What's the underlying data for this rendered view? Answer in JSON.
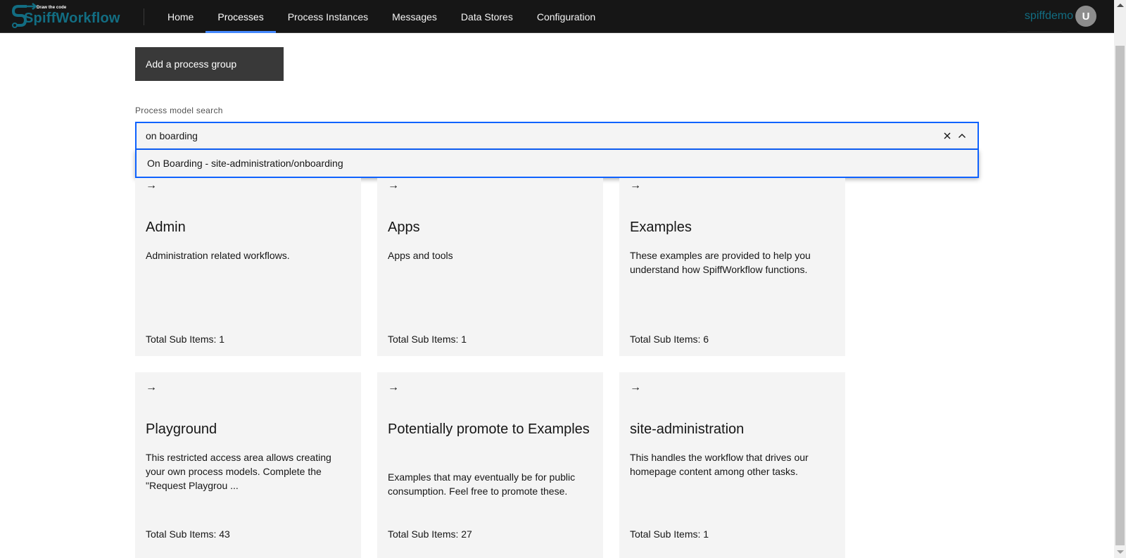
{
  "app": {
    "logo_tagline": "Draw the code",
    "logo_name": "SpiffWorkflow",
    "brand_color": "#126d82",
    "accent_color": "#0f62fe"
  },
  "nav": {
    "items": [
      {
        "label": "Home",
        "active": false
      },
      {
        "label": "Processes",
        "active": true
      },
      {
        "label": "Process Instances",
        "active": false
      },
      {
        "label": "Messages",
        "active": false
      },
      {
        "label": "Data Stores",
        "active": false
      },
      {
        "label": "Configuration",
        "active": false
      }
    ]
  },
  "user": {
    "username": "spiffdemo",
    "avatar_initial": "U"
  },
  "toolbar": {
    "add_group_label": "Add a process group"
  },
  "search": {
    "label": "Process model search",
    "value": "on boarding",
    "results": [
      "On Boarding - site-administration/onboarding"
    ]
  },
  "cards": [
    {
      "title": "Admin",
      "description": "Administration related workflows.",
      "count_label": "Total Sub Items: 1"
    },
    {
      "title": "Apps",
      "description": "Apps and tools",
      "count_label": "Total Sub Items: 1"
    },
    {
      "title": "Examples",
      "description": "These examples are provided to help you understand how SpiffWorkflow functions.",
      "count_label": "Total Sub Items: 6"
    },
    {
      "title": "Playground",
      "description": "This restricted access area allows creating your own process models. Complete the \"Request Playgrou ...",
      "count_label": "Total Sub Items: 43"
    },
    {
      "title": "Potentially promote to Examples",
      "description": "Examples that may eventually be for public consumption. Feel free to promote these.",
      "count_label": "Total Sub Items: 27"
    },
    {
      "title": "site-administration",
      "description": "This handles the workflow that drives our homepage content among other tasks.",
      "count_label": "Total Sub Items: 1"
    }
  ],
  "icons": {
    "card_arrow": "→"
  }
}
